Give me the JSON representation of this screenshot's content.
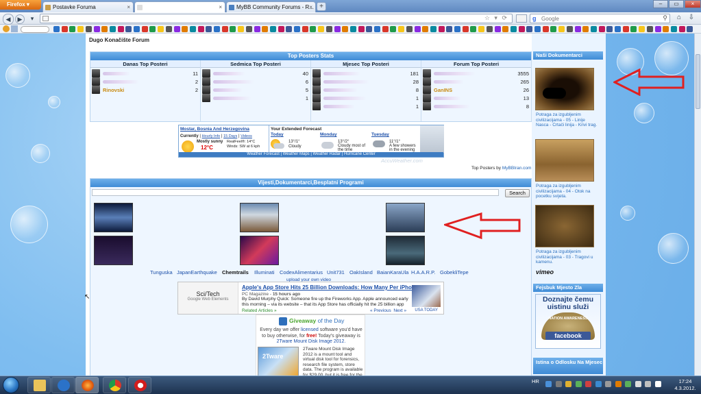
{
  "browser": {
    "app_button": "Firefox",
    "tabs": [
      {
        "title": "Postavke Foruma"
      },
      {
        "title": ""
      },
      {
        "title": "MyBB Community Forums - R..."
      }
    ],
    "search_placeholder": "Google"
  },
  "page": {
    "forum_title": "Dugo Konačište Forum",
    "top_posters": {
      "header": "Top Posters Stats",
      "columns": [
        {
          "title": "Danas Top Posteri",
          "rows": [
            {
              "name": "",
              "count": "11"
            },
            {
              "name": "",
              "count": "2"
            },
            {
              "name": "Rinovski",
              "count": "2"
            }
          ]
        },
        {
          "title": "Sedmica Top Posteri",
          "rows": [
            {
              "name": "",
              "count": "40"
            },
            {
              "name": "",
              "count": "6"
            },
            {
              "name": "",
              "count": "5"
            },
            {
              "name": "",
              "count": "1"
            }
          ]
        },
        {
          "title": "Mjesec Top Posteri",
          "rows": [
            {
              "name": "",
              "count": "181"
            },
            {
              "name": "",
              "count": "28"
            },
            {
              "name": "",
              "count": "8"
            },
            {
              "name": "",
              "count": "1"
            },
            {
              "name": "",
              "count": "1"
            }
          ]
        },
        {
          "title": "Forum Top Posteri",
          "rows": [
            {
              "name": "",
              "count": "3555"
            },
            {
              "name": "",
              "count": "265"
            },
            {
              "name": "GanINS",
              "count": "26"
            },
            {
              "name": "",
              "count": "13"
            },
            {
              "name": "",
              "count": "8"
            }
          ]
        }
      ]
    },
    "weather": {
      "location": "Mostar, Bosnia And Herzegovina",
      "currently_label": "Currently",
      "links": [
        "Hourly Info",
        "15 Days",
        "Videos"
      ],
      "current_condition": "Mostly sunny",
      "current_temp": "12°C",
      "realfeel": "RealFeel®: 14°C",
      "wind": "Winds: SW at 6 kph",
      "extended_title": "Your Extended Forecast",
      "forecast": [
        {
          "day": "Today",
          "temps": "13°/1°",
          "desc": "Cloudy"
        },
        {
          "day": "Monday",
          "temps": "13°/2°",
          "desc": "Cloudy most of the time"
        },
        {
          "day": "Tuesday",
          "temps": "11°/1°",
          "desc": "A few showers in the evening"
        }
      ],
      "footer": "Weather Forecast | Weather Maps | Weather Radar | Hurricane Center",
      "brand": "AccuWeather.com"
    },
    "top_posters_by": "Top Posters by",
    "top_posters_by_link": "MyBBIran.com",
    "videos": {
      "header": "Vijesti,Dokumentarci,Besplatni Programi",
      "search_button": "Search",
      "labels": [
        "Tunguska",
        "JapanEarthquake",
        "Chemtrails",
        "Illuminati",
        "CodexAlimentarius",
        "Unit731",
        "OakIsland",
        "BaianKaraUla",
        "H.A.A.R.P.",
        "GobekliTepe"
      ],
      "upload_link": "upload your own video"
    },
    "news": {
      "label_top": "Sci/Tech",
      "label_bottom": "Google Web Elements",
      "headline": "Apple's App Store Hits 25 Billion Downloads: How Many Per iPhone?",
      "source": "PC Magazine",
      "age": "15 hours ago",
      "body": "By David Murphy Quick: Someone fire up the Fireworks App. Apple announced early this morning – via its website – that its App Store has officially hit the 25 billion app",
      "related": "Related Articles »",
      "prev": "« Previous",
      "next": "Next »",
      "image_caption": "USA TODAY"
    },
    "giveaway": {
      "title_a": "Giveaway",
      "title_b": "of the Day",
      "text_1": "Every day we offer",
      "text_licensed": "licensed",
      "text_2": "software you'd have to buy otherwise, for",
      "text_free": "free!",
      "text_3": "Today's giveaway is",
      "product": "2Tware Mount Disk Image 2012.",
      "box_label": "2Tware",
      "desc": "2Tware Mount Disk Image 2012 is a mount tool and virtual disk tool for forensics, research file system, store data. The program is available for $29.00, but it is free for the visitors"
    }
  },
  "sidebar": {
    "docs_header": "Naši Dokumentarci",
    "docs": [
      {
        "caption": "Potraga za izgubljenim civilizacijama - 05 - Linije Nasca - Crtači linija - Krivi trag."
      },
      {
        "caption": "Potraga za izgubljenim civilizacijama - 04 - Otok na pocetku svijeta."
      },
      {
        "caption": "Potraga za izgubljenim civilizacijama - 03 - Tragovi u kamenu."
      }
    ],
    "vimeo": "vimeo",
    "fb_header": "Fejsbuk Mjesto Zla",
    "fb_ad_text": "Doznajte čemu uistinu služi",
    "fb_seal_text": "NATION AWARENESS",
    "fb_brand": "facebook",
    "istina_header": "Istina o Odlosku Na Mjesec"
  },
  "taskbar": {
    "language": "HR",
    "time": "17:24",
    "date": "4.3.2012."
  },
  "colors": {
    "panel_header": "#3f8bd6",
    "page_background": "#7ebdf0",
    "annotation_arrow": "#e02020",
    "link": "#1a4ea8"
  }
}
